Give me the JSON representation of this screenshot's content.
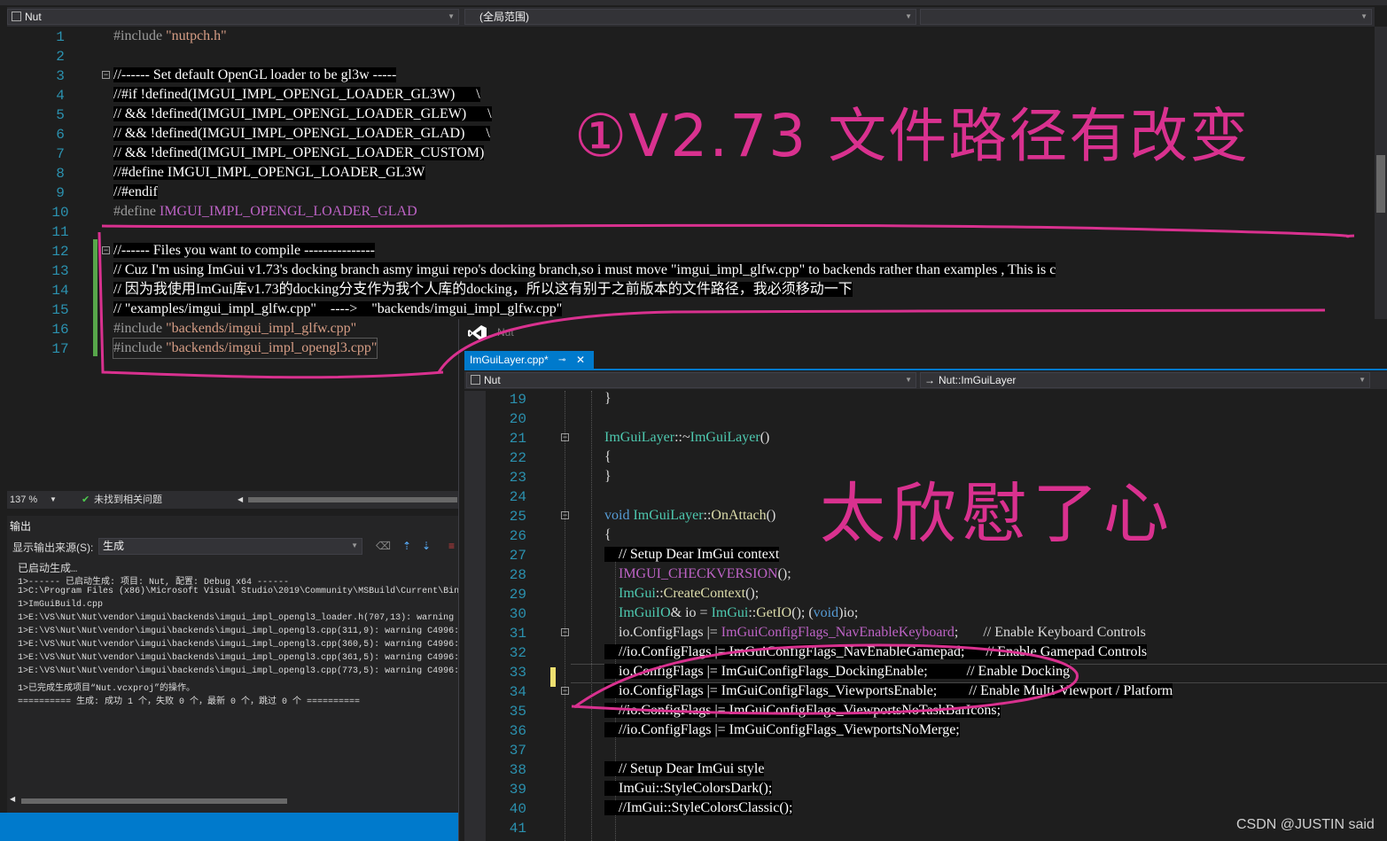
{
  "nav": {
    "project": "Nut",
    "scope": "(全局范围)"
  },
  "main_editor": {
    "line_numbers": [
      "1",
      "2",
      "3",
      "4",
      "5",
      "6",
      "7",
      "8",
      "9",
      "10",
      "11",
      "12",
      "13",
      "14",
      "15",
      "16",
      "17"
    ],
    "lines": [
      {
        "n": "1",
        "a": "#include ",
        "b": "\"nutpch.h\"",
        "c": ""
      },
      {
        "n": "2",
        "a": "",
        "b": "",
        "c": ""
      },
      {
        "n": "3",
        "a": "//------ Set default OpenGL loader to be gl3w -----",
        "b": "",
        "c": ""
      },
      {
        "n": "4",
        "a": "//#if !defined(IMGUI_IMPL_OPENGL_LOADER_GL3W)      \\",
        "b": "",
        "c": ""
      },
      {
        "n": "5",
        "a": "// && !defined(IMGUI_IMPL_OPENGL_LOADER_GLEW)      \\",
        "b": "",
        "c": ""
      },
      {
        "n": "6",
        "a": "// && !defined(IMGUI_IMPL_OPENGL_LOADER_GLAD)      \\",
        "b": "",
        "c": ""
      },
      {
        "n": "7",
        "a": "// && !defined(IMGUI_IMPL_OPENGL_LOADER_CUSTOM)",
        "b": "",
        "c": ""
      },
      {
        "n": "8",
        "a": "//#define IMGUI_IMPL_OPENGL_LOADER_GL3W",
        "b": "",
        "c": ""
      },
      {
        "n": "9",
        "a": "//#endif",
        "b": "",
        "c": ""
      },
      {
        "n": "10",
        "a": "#define ",
        "b": "IMGUI_IMPL_OPENGL_LOADER_GLAD",
        "c": ""
      },
      {
        "n": "11",
        "a": "",
        "b": "",
        "c": ""
      },
      {
        "n": "12",
        "a": "//------ Files you want to compile ---------------",
        "b": "",
        "c": ""
      },
      {
        "n": "13",
        "a": "// Cuz I'm using ImGui v1.73's docking branch asmy imgui repo's docking branch,so i must move \"imgui_impl_glfw.cpp\" to backends rather than examples , This is c",
        "b": "",
        "c": ""
      },
      {
        "n": "14",
        "a": "// 因为我使用ImGui库v1.73的docking分支作为我个人库的docking，所以这有别于之前版本的文件路径，我必须移动一下",
        "b": "",
        "c": ""
      },
      {
        "n": "15",
        "a": "// \"examples/imgui_impl_glfw.cpp\"    ---->    \"backends/imgui_impl_glfw.cpp\"",
        "b": "",
        "c": ""
      },
      {
        "n": "16",
        "a": "#include ",
        "b": "\"backends/imgui_impl_glfw.cpp\"",
        "c": ""
      },
      {
        "n": "17",
        "a": "#include ",
        "b": "\"backends/imgui_impl_opengl3.cpp\"",
        "c": ""
      }
    ]
  },
  "status": {
    "zoom": "137 %",
    "issues": "未找到相关问题"
  },
  "output": {
    "title": "输出",
    "source_label": "显示输出来源(S):",
    "source_value": "生成",
    "lines": [
      "已启动生成…",
      "1>------ 已启动生成: 项目: Nut, 配置: Debug x64 ------",
      "1>C:\\Program Files (x86)\\Microsoft Visual Studio\\2019\\Community\\MSBuild\\Current\\Bin",
      "1>ImGuiBuild.cpp",
      "1>E:\\VS\\Nut\\Nut\\vendor\\imgui\\backends\\imgui_impl_opengl3_loader.h(707,13): warning",
      "1>E:\\VS\\Nut\\Nut\\vendor\\imgui\\backends\\imgui_impl_opengl3.cpp(311,9): warning C4996:",
      "1>E:\\VS\\Nut\\Nut\\vendor\\imgui\\backends\\imgui_impl_opengl3.cpp(360,5): warning C4996:",
      "1>E:\\VS\\Nut\\Nut\\vendor\\imgui\\backends\\imgui_impl_opengl3.cpp(361,5): warning C4996:",
      "1>E:\\VS\\Nut\\Nut\\vendor\\imgui\\backends\\imgui_impl_opengl3.cpp(773,5): warning C4996:",
      "1>已完成生成项目“Nut.vcxproj”的操作。",
      "========== 生成: 成功 1 个，失败 0 个，最新 0 个，跳过 0 个 =========="
    ]
  },
  "float_window": {
    "title": "Nut",
    "tab_label": "ImGuiLayer.cpp*",
    "pin_glyph": "⊸",
    "close_glyph": "✕",
    "project": "Nut",
    "scope": "Nut::ImGuiLayer",
    "lines": [
      {
        "n": "19",
        "t": "}"
      },
      {
        "n": "20",
        "t": ""
      },
      {
        "n": "21",
        "t": "ImGuiLayer::~ImGuiLayer()"
      },
      {
        "n": "22",
        "t": "{"
      },
      {
        "n": "23",
        "t": "}"
      },
      {
        "n": "24",
        "t": ""
      },
      {
        "n": "25",
        "t": "void ImGuiLayer::OnAttach()"
      },
      {
        "n": "26",
        "t": "{"
      },
      {
        "n": "27",
        "t": "    // Setup Dear ImGui context"
      },
      {
        "n": "28",
        "t": "    IMGUI_CHECKVERSION();"
      },
      {
        "n": "29",
        "t": "    ImGui::CreateContext();"
      },
      {
        "n": "30",
        "t": "    ImGuiIO& io = ImGui::GetIO(); (void)io;"
      },
      {
        "n": "31",
        "t": "    io.ConfigFlags |= ImGuiConfigFlags_NavEnableKeyboard;       // Enable Keyboard Controls"
      },
      {
        "n": "32",
        "t": "    //io.ConfigFlags |= ImGuiConfigFlags_NavEnableGamepad;      // Enable Gamepad Controls"
      },
      {
        "n": "33",
        "t": "    io.ConfigFlags |= ImGuiConfigFlags_DockingEnable;           // Enable Docking"
      },
      {
        "n": "34",
        "t": "    io.ConfigFlags |= ImGuiConfigFlags_ViewportsEnable;         // Enable Multi-Viewport / Platform"
      },
      {
        "n": "35",
        "t": "    //io.ConfigFlags |= ImGuiConfigFlags_ViewportsNoTaskBarIcons;"
      },
      {
        "n": "36",
        "t": "    //io.ConfigFlags |= ImGuiConfigFlags_ViewportsNoMerge;"
      },
      {
        "n": "37",
        "t": ""
      },
      {
        "n": "38",
        "t": "    // Setup Dear ImGui style"
      },
      {
        "n": "39",
        "t": "    ImGui::StyleColorsDark();"
      },
      {
        "n": "40",
        "t": "    //ImGui::StyleColorsClassic();"
      },
      {
        "n": "41",
        "t": ""
      }
    ]
  },
  "annotations": {
    "note1": "①V2.73 文件路径有改变",
    "note2": "太欣慰了心"
  },
  "watermark": "CSDN @JUSTIN said",
  "colors": {
    "ink": "#d9318f",
    "accent": "#007acc",
    "comment": "#57a64a",
    "string": "#d69d85",
    "macro": "#bd63c5",
    "keyword": "#569cd6",
    "type": "#4ec9b0"
  }
}
